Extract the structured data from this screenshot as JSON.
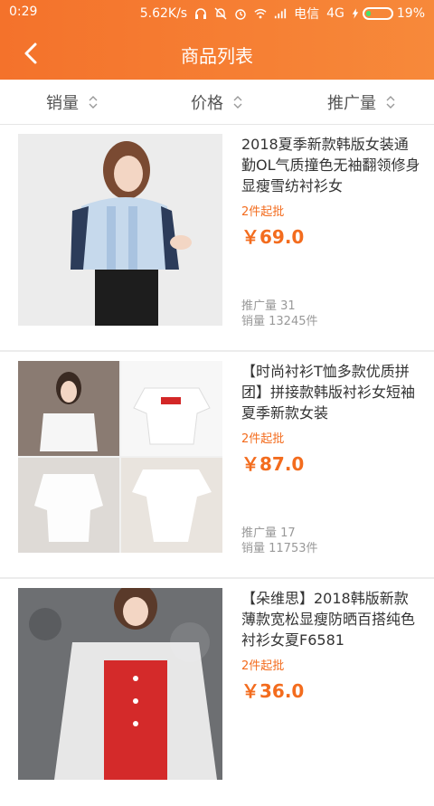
{
  "status_bar": {
    "time": "0:29",
    "net_speed": "5.62K/s",
    "carrier": "电信",
    "network": "4G",
    "battery": "19%",
    "battery_level": 0.19
  },
  "nav": {
    "title": "商品列表",
    "back_icon": "chevron-left-icon"
  },
  "sort_bar": {
    "items": [
      {
        "label": "销量"
      },
      {
        "label": "价格"
      },
      {
        "label": "推广量"
      }
    ]
  },
  "colors": {
    "header_start": "#f4722b",
    "header_end": "#f7893a",
    "accent": "#f36c1e"
  },
  "products": [
    {
      "title": "2018夏季新款韩版女装通勤OL气质撞色无袖翻领修身显瘦雪纺衬衫女",
      "min_buy": "2件起批",
      "price": "￥69.0",
      "promo": "推广量 31",
      "sales": "销量 13245件"
    },
    {
      "title": "【时尚衬衫T恤多款优质拼团】拼接款韩版衬衫女短袖夏季新款女装",
      "min_buy": "2件起批",
      "price": "￥87.0",
      "promo": "推广量 17",
      "sales": "销量 11753件"
    },
    {
      "title": "【朵维思】2018韩版新款薄款宽松显瘦防晒百搭纯色衬衫女夏F6581",
      "min_buy": "2件起批",
      "price": "￥36.0",
      "promo": "",
      "sales": ""
    }
  ]
}
